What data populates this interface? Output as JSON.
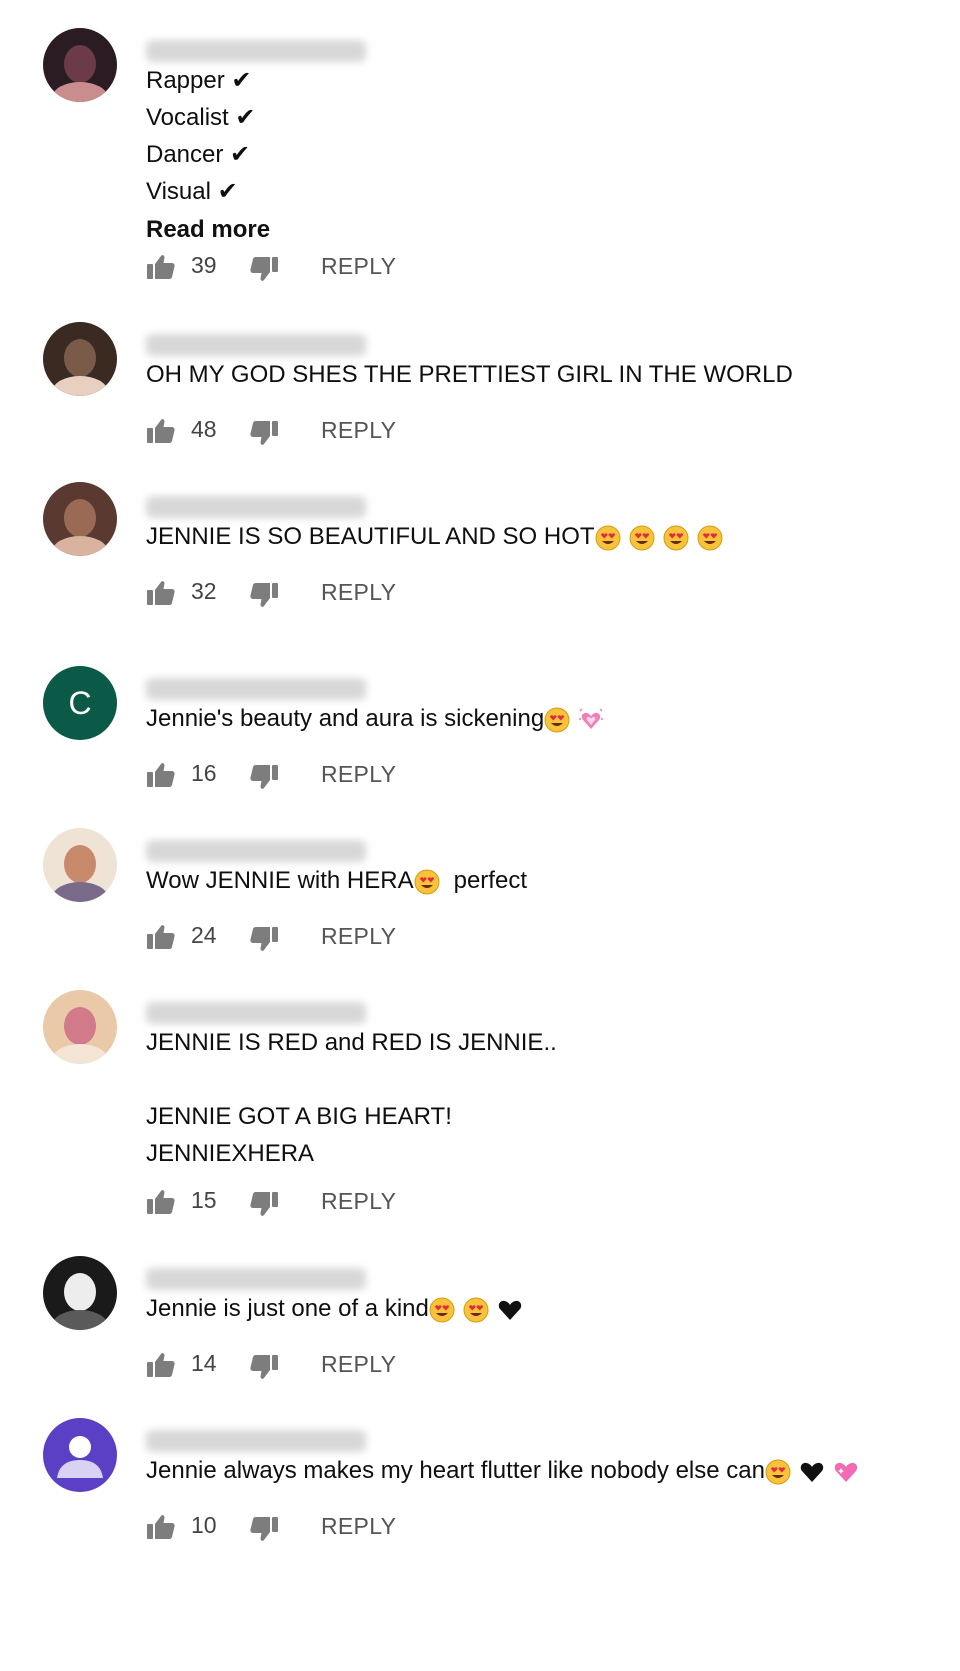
{
  "comments": [
    {
      "author": "Multifandom beauty",
      "lines": [
        "Rapper ✔",
        "Vocalist ✔",
        "Dancer ✔",
        "Visual ✔"
      ],
      "emoji": [],
      "read_more": "Read more",
      "likes": "39",
      "reply": "REPLY"
    },
    {
      "author": "Viviana Fraire",
      "lines": [
        "OH MY GOD SHES THE PRETTIEST GIRL IN THE WORLD"
      ],
      "emoji": [],
      "likes": "48",
      "reply": "REPLY"
    },
    {
      "author": "salins de ocampo",
      "lines": [
        "JENNIE IS SO BEAUTIFUL AND SO HOT"
      ],
      "emoji": [
        "heart-eyes-emoji",
        "heart-eyes-emoji",
        "heart-eyes-emoji",
        "heart-eyes-emoji"
      ],
      "likes": "32",
      "reply": "REPLY"
    },
    {
      "author": "Claudia Torres Castillo",
      "avatar_letter": "C",
      "lines": [
        "Jennie's beauty and aura is sickening"
      ],
      "emoji": [
        "heart-eyes-emoji",
        "growing-heart-emoji"
      ],
      "likes": "16",
      "reply": "REPLY"
    },
    {
      "author": "Paola Min",
      "lines": [
        "Wow JENNIE with HERA"
      ],
      "emoji": [
        "heart-eyes-emoji"
      ],
      "after_emoji": "perfect",
      "likes": "24",
      "reply": "REPLY"
    },
    {
      "author": "Limarichi Nabon",
      "lines": [
        "JENNIE IS RED and RED IS JENNIE..",
        "",
        "JENNIE GOT A BIG HEART!",
        "JENNIEXHERA"
      ],
      "emoji": [],
      "likes": "15",
      "reply": "REPLY"
    },
    {
      "author": "Chatmas Hermans",
      "lines": [
        "Jennie is just one of a kind"
      ],
      "emoji": [
        "heart-eyes-emoji",
        "heart-eyes-emoji",
        "black-heart-emoji"
      ],
      "likes": "14",
      "reply": "REPLY"
    },
    {
      "author": "Kuma Kim",
      "lines": [
        "Jennie always makes my heart flutter like nobody else can"
      ],
      "emoji": [
        "heart-eyes-emoji",
        "black-heart-emoji",
        "sparkling-heart-emoji"
      ],
      "likes": "10",
      "reply": "REPLY"
    }
  ],
  "colors": {
    "text": "#0f0f0f",
    "muted": "#555555",
    "avatar_c": "#0b5a47",
    "avatar_default": "#5b3fc4"
  }
}
